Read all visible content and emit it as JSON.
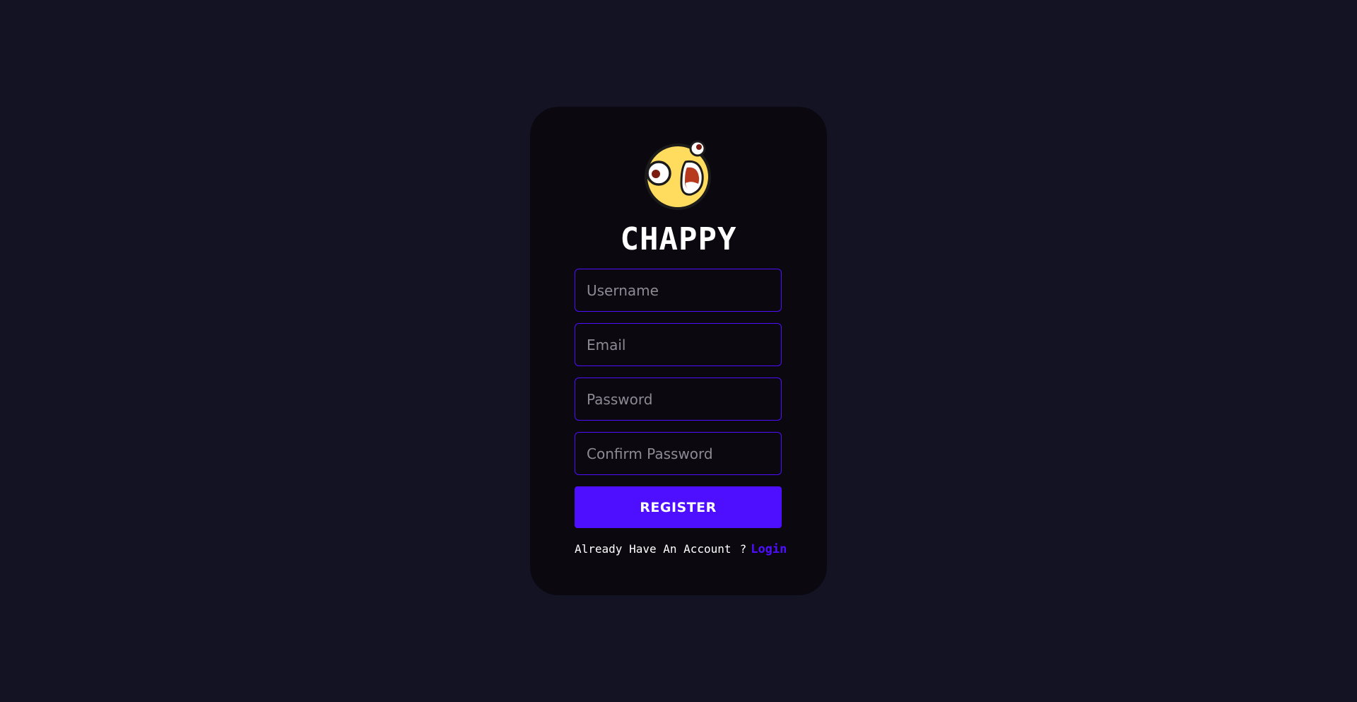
{
  "brand": {
    "name": "CHAPPY",
    "logo_icon": "surprised-face-logo"
  },
  "form": {
    "username": {
      "placeholder": "Username",
      "value": ""
    },
    "email": {
      "placeholder": "Email",
      "value": ""
    },
    "password": {
      "placeholder": "Password",
      "value": ""
    },
    "confirm_password": {
      "placeholder": "Confirm Password",
      "value": ""
    },
    "submit_label": "REGISTER"
  },
  "footer": {
    "prompt": "Already Have An Account",
    "emoji_icon": "flushed-face-icon",
    "question_mark": "?",
    "login_link": "Login"
  },
  "colors": {
    "background": "#131324",
    "card": "#0b0810",
    "accent": "#4e0eff",
    "text": "#ffffff",
    "placeholder": "#8d8a94"
  }
}
